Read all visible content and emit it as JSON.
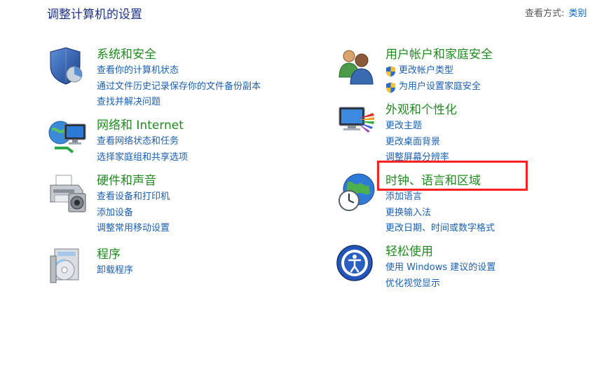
{
  "header": {
    "title": "调整计算机的设置",
    "view_by_label": "查看方式:",
    "view_by_value": "类别"
  },
  "categories": [
    {
      "heading": "系统和安全",
      "icon": "shield-icon",
      "links": [
        "查看你的计算机状态",
        "通过文件历史记录保存你的文件备份副本",
        "查找并解决问题"
      ]
    },
    {
      "heading": "网络和 Internet",
      "icon": "network-icon",
      "links": [
        "查看网络状态和任务",
        "选择家庭组和共享选项"
      ]
    },
    {
      "heading": "硬件和声音",
      "icon": "printer-icon",
      "links": [
        "查看设备和打印机",
        "添加设备",
        "调整常用移动设置"
      ]
    },
    {
      "heading": "程序",
      "icon": "programs-icon",
      "links": [
        "卸载程序"
      ]
    },
    {
      "heading": "用户帐户和家庭安全",
      "icon": "users-icon",
      "links": [
        "更改帐户类型",
        "为用户设置家庭安全"
      ]
    },
    {
      "heading": "外观和个性化",
      "icon": "appearance-icon",
      "links": [
        "更改主题",
        "更改桌面背景",
        "调整屏幕分辨率"
      ]
    },
    {
      "heading": "时钟、语言和区域",
      "icon": "globe-clock-icon",
      "links": [
        "添加语言",
        "更换输入法",
        "更改日期、时间或数字格式"
      ]
    },
    {
      "heading": "轻松使用",
      "icon": "ease-of-access-icon",
      "links": [
        "使用 Windows 建议的设置",
        "优化视觉显示"
      ]
    }
  ],
  "colors": {
    "heading": "#1e8c1e",
    "link": "#1a5fb4",
    "title": "#1e3287",
    "highlight": "#ff2020"
  }
}
